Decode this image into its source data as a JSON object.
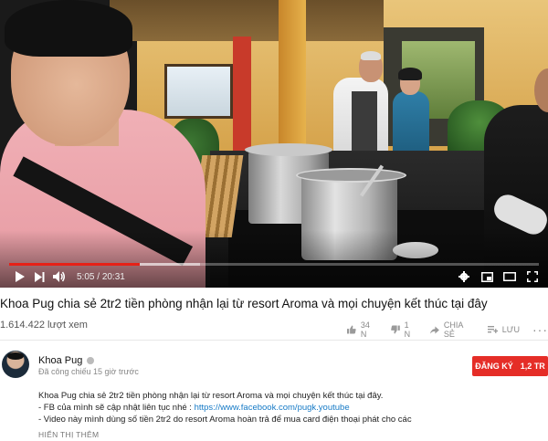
{
  "player": {
    "current_time": "5:05",
    "duration": "20:31",
    "progress": 0.246,
    "buffered": 0.36,
    "accent_color": "#e62117"
  },
  "video": {
    "title": "Khoa Pug chia sẻ 2tr2 tiền phòng nhận lại từ resort Aroma và mọi chuyện kết thúc tại đây",
    "views": "1.614.422 lượt xem",
    "like_count": "34 N",
    "dislike_count": "1 N",
    "share_label": "CHIA SẺ",
    "save_label": "LƯU"
  },
  "channel": {
    "name": "Khoa Pug",
    "published": "Đã công chiếu 15 giờ trước",
    "subscribe_label": "ĐĂNG KÝ",
    "subscriber_count": "1,2 TR",
    "subscribe_color": "#e52d27"
  },
  "description": {
    "line1": "Khoa Pug chia sẻ 2tr2 tiền phòng nhận lại từ resort Aroma và mọi chuyện kết thúc tại đây.",
    "line2_prefix": "- FB của mình sẽ cập nhật liên tục nhé : ",
    "line2_link": "https://www.facebook.com/pugk.youtube",
    "line3": "- Video này mình dùng số tiền 2tr2 do resort Aroma hoàn trả để mua card điện thoại phát cho các",
    "show_more": "HIỂN THỊ THÊM"
  },
  "icons": {
    "play": "play-icon",
    "next": "next-icon",
    "volume": "volume-icon",
    "settings": "gear-icon",
    "miniplayer": "miniplayer-icon",
    "theater": "theater-icon",
    "fullscreen": "fullscreen-icon",
    "like": "thumbs-up-icon",
    "dislike": "thumbs-down-icon",
    "share": "share-icon",
    "save": "playlist-add-icon",
    "more": "more-icon"
  }
}
